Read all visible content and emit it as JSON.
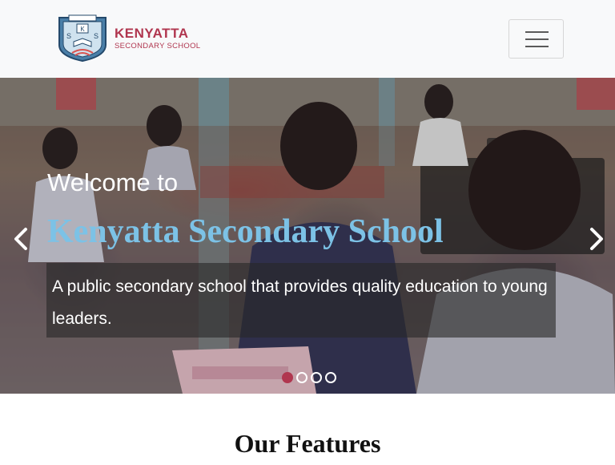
{
  "brand": {
    "name": "KENYATTA",
    "subtitle": "SECONDARY SCHOOL",
    "color": "#b0364f"
  },
  "navbar": {
    "toggler_icon": "hamburger-icon"
  },
  "carousel": {
    "welcome": "Welcome to",
    "title": "Kenyatta Secondary School",
    "description": "A public secondary school that provides quality education to young leaders.",
    "prev_icon": "chevron-left-icon",
    "next_icon": "chevron-right-icon",
    "slide_count": 4,
    "active_slide": 1,
    "title_color": "#7cc2e6"
  },
  "features": {
    "heading": "Our Features"
  }
}
